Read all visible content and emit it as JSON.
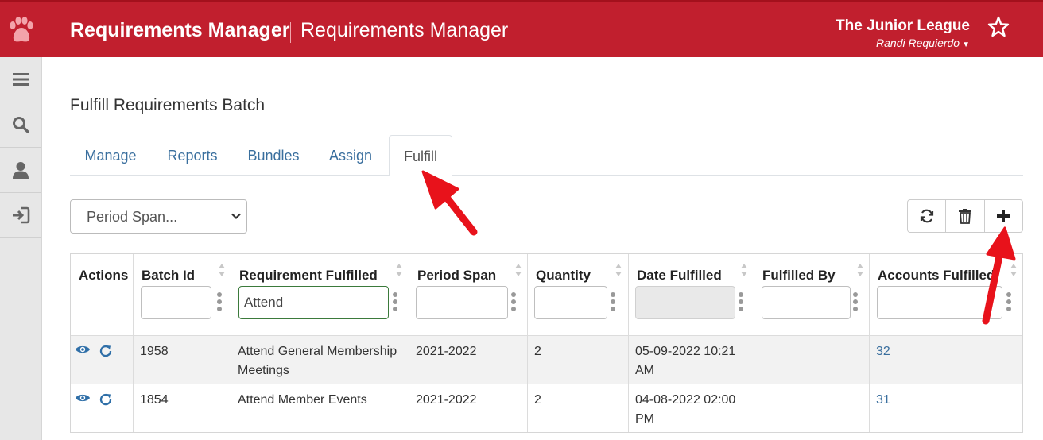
{
  "header": {
    "app_title": "Requirements Manager",
    "app_subtitle": "Requirements Manager",
    "org_name": "The Junior League",
    "user_name": "Randi Requierdo",
    "logo_icon": "paw-icon",
    "favorite_icon": "star-outline-icon"
  },
  "sidebar": {
    "items": [
      {
        "icon": "hamburger-menu-icon"
      },
      {
        "icon": "search-icon"
      },
      {
        "icon": "user-icon"
      },
      {
        "icon": "sign-out-icon"
      }
    ]
  },
  "page": {
    "title": "Fulfill Requirements Batch"
  },
  "tabs": [
    {
      "label": "Manage",
      "active": false
    },
    {
      "label": "Reports",
      "active": false
    },
    {
      "label": "Bundles",
      "active": false
    },
    {
      "label": "Assign",
      "active": false
    },
    {
      "label": "Fulfill",
      "active": true
    }
  ],
  "toolbar": {
    "period_select_value": "Period Span...",
    "buttons": [
      {
        "icon": "refresh-icon"
      },
      {
        "icon": "trash-icon"
      },
      {
        "icon": "plus-icon"
      }
    ]
  },
  "table": {
    "columns": [
      {
        "label": "Actions",
        "filter": null
      },
      {
        "label": "Batch Id",
        "filter": ""
      },
      {
        "label": "Requirement Fulfilled",
        "filter": "Attend"
      },
      {
        "label": "Period Span",
        "filter": ""
      },
      {
        "label": "Quantity",
        "filter": ""
      },
      {
        "label": "Date Fulfilled",
        "filter": ""
      },
      {
        "label": "Fulfilled By",
        "filter": ""
      },
      {
        "label": "Accounts Fulfilled",
        "filter": ""
      }
    ],
    "rows": [
      {
        "batch_id": "1958",
        "requirement": "Attend General Membership Meetings",
        "period_span": "2021-2022",
        "quantity": "2",
        "date_fulfilled": "05-09-2022 10:21 AM",
        "fulfilled_by": "",
        "accounts_fulfilled": "32"
      },
      {
        "batch_id": "1854",
        "requirement": "Attend Member Events",
        "period_span": "2021-2022",
        "quantity": "2",
        "date_fulfilled": "04-08-2022 02:00 PM",
        "fulfilled_by": "",
        "accounts_fulfilled": "31"
      }
    ]
  },
  "colors": {
    "brand_red": "#c11f2e",
    "link_blue": "#3a6f9e",
    "annotation_red": "#e8121b"
  }
}
